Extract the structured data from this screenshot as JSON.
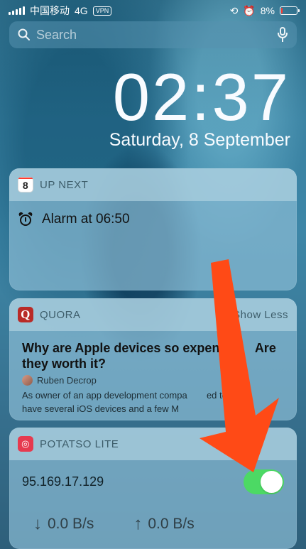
{
  "status_bar": {
    "carrier": "中国移动",
    "network": "4G",
    "vpn": "VPN",
    "battery": "8%"
  },
  "search": {
    "placeholder": "Search"
  },
  "lock_screen": {
    "time": "02:37",
    "date": "Saturday, 8 September"
  },
  "widgets": {
    "up_next": {
      "title": "UP NEXT",
      "calendar_day": "8",
      "event": "Alarm at 06:50"
    },
    "quora": {
      "title": "QUORA",
      "action": "Show Less",
      "icon_letter": "Q",
      "question_part1": "Why are Apple devices so expensi",
      "question_part2": "Are they worth it?",
      "author": "Ruben Decrop",
      "answer_line1": "As owner of an app development compa",
      "answer_line2": "ed to",
      "answer_line3": "have several iOS devices and a few M",
      "answer_line4": "..."
    },
    "potatso": {
      "title": "POTATSO LITE",
      "server": "95.169.17.129",
      "download": "0.0 B/s",
      "upload": "0.0 B/s",
      "enabled": true
    }
  },
  "colors": {
    "toggle_on": "#4cd964",
    "battery_low": "#ff3b30",
    "quora_red": "#b92b27",
    "overlay_arrow": "#ff4a16"
  }
}
